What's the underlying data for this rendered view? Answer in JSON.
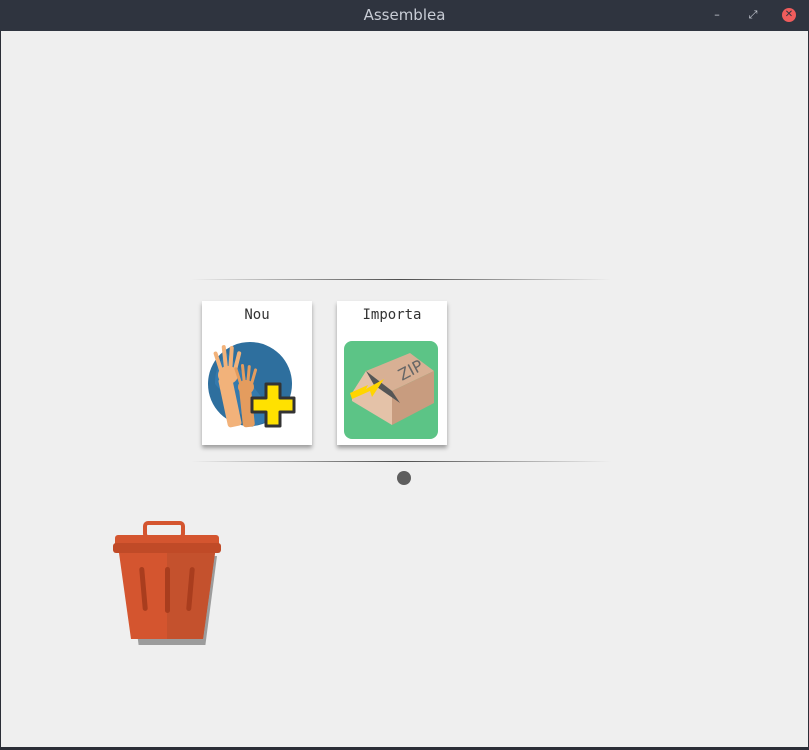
{
  "window": {
    "title": "Assemblea"
  },
  "cards": [
    {
      "label": "Nou",
      "icon": "hands-add-icon"
    },
    {
      "label": "Importa",
      "icon": "zip-import-icon"
    }
  ],
  "pager": {
    "pages": 1,
    "current": 1
  },
  "trash": {
    "icon": "trash-icon"
  },
  "colors": {
    "titlebar": "#2f343f",
    "background": "#efefef",
    "close": "#f05c5c",
    "trash": "#d4552f"
  }
}
